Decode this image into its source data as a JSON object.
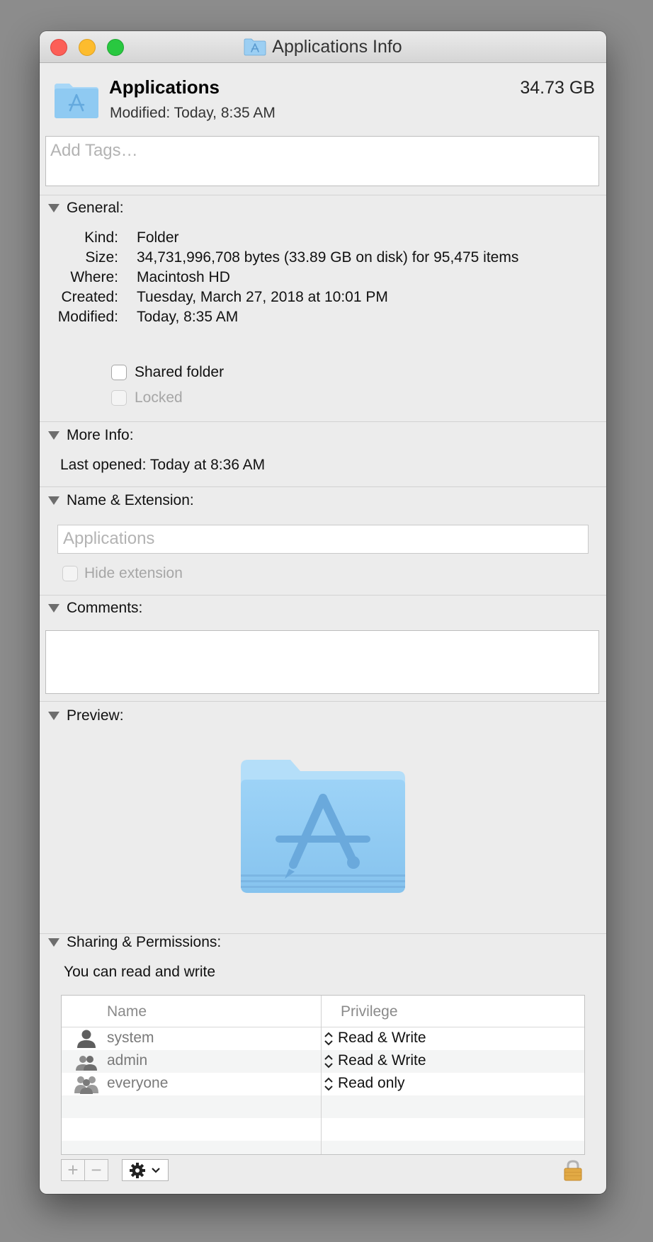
{
  "window": {
    "title": "Applications Info"
  },
  "header": {
    "name": "Applications",
    "modified": "Modified: Today, 8:35 AM",
    "size": "34.73 GB"
  },
  "tags": {
    "placeholder": "Add Tags…"
  },
  "general": {
    "heading": "General:",
    "rows": [
      {
        "label": "Kind:",
        "value": "Folder"
      },
      {
        "label": "Size:",
        "value": "34,731,996,708 bytes (33.89 GB on disk) for 95,475 items"
      },
      {
        "label": "Where:",
        "value": "Macintosh HD"
      },
      {
        "label": "Created:",
        "value": "Tuesday, March 27, 2018 at 10:01 PM"
      },
      {
        "label": "Modified:",
        "value": "Today, 8:35 AM"
      }
    ],
    "shared_folder_label": "Shared folder",
    "shared_folder_checked": false,
    "locked_label": "Locked",
    "locked_checked": false
  },
  "more_info": {
    "heading": "More Info:",
    "last_opened_label": "Last opened:",
    "last_opened_value": "Today at 8:36 AM"
  },
  "name_extension": {
    "heading": "Name & Extension:",
    "placeholder": "Applications",
    "hide_extension_label": "Hide extension",
    "hide_extension_checked": false
  },
  "comments": {
    "heading": "Comments:",
    "value": ""
  },
  "preview": {
    "heading": "Preview:",
    "icon": "applications-folder-icon"
  },
  "sharing": {
    "heading": "Sharing & Permissions:",
    "summary": "You can read and write",
    "columns": [
      "Name",
      "Privilege"
    ],
    "rows": [
      {
        "icon": "single-user-icon",
        "name": "system",
        "privilege": "Read & Write"
      },
      {
        "icon": "group-icon",
        "name": "admin",
        "privilege": "Read & Write"
      },
      {
        "icon": "everyone-icon",
        "name": "everyone",
        "privilege": "Read only"
      }
    ],
    "add_label": "+",
    "remove_label": "−"
  },
  "colors": {
    "folder_blue": "#8fcaf2",
    "folder_blue_dark": "#6fb2e4",
    "traffic_close": "#fc5f57",
    "traffic_min": "#fdbc2e",
    "traffic_max": "#29c840",
    "lock": "#e1a944"
  }
}
